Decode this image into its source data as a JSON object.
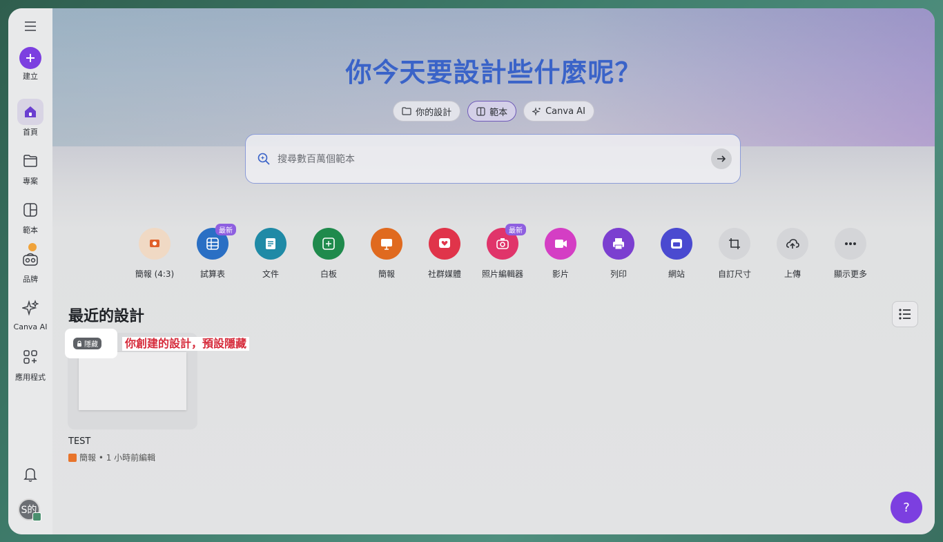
{
  "sidebar": {
    "items": [
      {
        "label": "建立",
        "icon": "plus-icon"
      },
      {
        "label": "首頁",
        "icon": "home-icon"
      },
      {
        "label": "專案",
        "icon": "folder-icon"
      },
      {
        "label": "範本",
        "icon": "template-icon"
      },
      {
        "label": "品牌",
        "icon": "brand-icon"
      },
      {
        "label": "Canva AI",
        "icon": "sparkle-icon"
      },
      {
        "label": "應用程式",
        "icon": "apps-icon"
      }
    ],
    "avatar_text": "S的"
  },
  "header": {
    "title": "你今天要設計些什麼呢？",
    "pills": [
      {
        "label": "你的設計",
        "icon": "folder-icon"
      },
      {
        "label": "範本",
        "icon": "template-icon"
      },
      {
        "label": "Canva AI",
        "icon": "sparkle-icon"
      }
    ]
  },
  "search": {
    "placeholder": "搜尋數百萬個範本"
  },
  "design_types": [
    {
      "label": "簡報 (4:3)",
      "color": "#f0d9c4",
      "icon": "presentation-icon"
    },
    {
      "label": "試算表",
      "color": "#2a6fc4",
      "badge": "最新",
      "icon": "sheet-icon"
    },
    {
      "label": "文件",
      "color": "#1f8aa6",
      "icon": "doc-icon"
    },
    {
      "label": "白板",
      "color": "#1f8a4c",
      "icon": "whiteboard-icon"
    },
    {
      "label": "簡報",
      "color": "#e06a1f",
      "icon": "presentation-icon"
    },
    {
      "label": "社群媒體",
      "color": "#e0344a",
      "icon": "heart-icon"
    },
    {
      "label": "照片編輯器",
      "color": "#e0346a",
      "badge": "最新",
      "icon": "camera-icon"
    },
    {
      "label": "影片",
      "color": "#d43ec4",
      "icon": "video-icon"
    },
    {
      "label": "列印",
      "color": "#7b3fd0",
      "icon": "print-icon"
    },
    {
      "label": "網站",
      "color": "#4a4ad0",
      "icon": "website-icon"
    },
    {
      "label": "自訂尺寸",
      "color": "#d4d5d8",
      "icon": "resize-icon"
    },
    {
      "label": "上傳",
      "color": "#d4d5d8",
      "icon": "upload-icon"
    },
    {
      "label": "顯示更多",
      "color": "#d4d5d8",
      "icon": "more-icon"
    }
  ],
  "recent": {
    "title": "最近的設計",
    "hidden_label": "隱藏",
    "annotation": "你創建的設計，預設隱藏",
    "card_title": "TEST",
    "card_meta": "簡報 • 1 小時前編輯"
  },
  "help_label": "?"
}
